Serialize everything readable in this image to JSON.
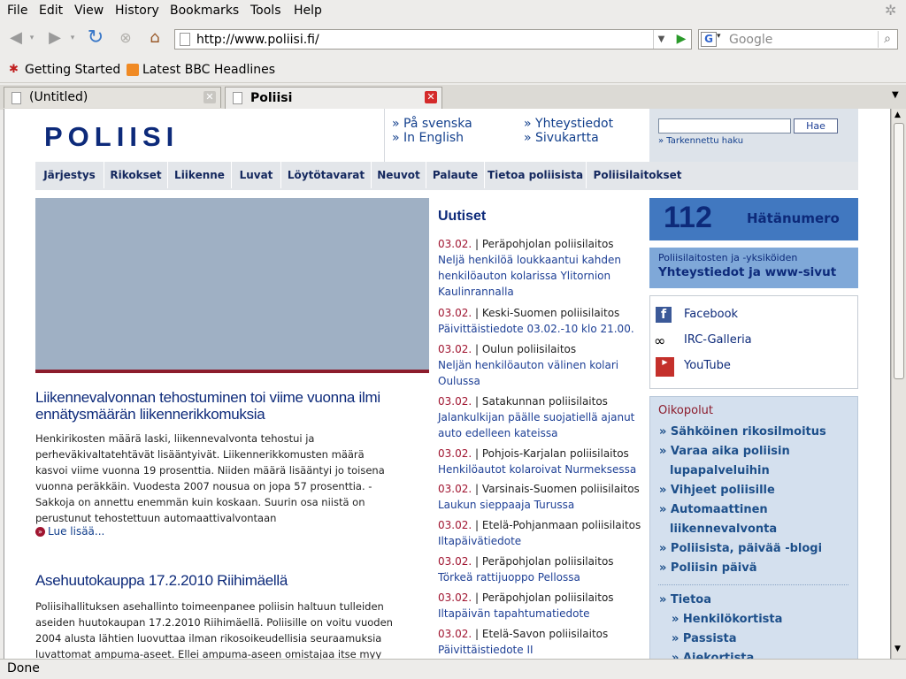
{
  "menu": [
    "File",
    "Edit",
    "View",
    "History",
    "Bookmarks",
    "Tools",
    "Help"
  ],
  "url": "http://www.poliisi.fi/",
  "search_placeholder": "Google",
  "bookmarks": [
    "Getting Started",
    "Latest BBC Headlines"
  ],
  "tabs": [
    {
      "label": "(Untitled)"
    },
    {
      "label": "Poliisi"
    }
  ],
  "status": "Done",
  "site": {
    "logo": "POLIISI",
    "lang_links": [
      "» På svenska",
      "» In English"
    ],
    "util_links": [
      "» Yhteystiedot",
      "» Sivukartta"
    ],
    "search_button": "Hae",
    "advanced_search": "» Tarkennettu haku",
    "nav": [
      "Järjestys",
      "Rikokset",
      "Liikenne",
      "Luvat",
      "Löytötavarat",
      "Neuvot",
      "Palaute",
      "Tietoa poliisista",
      "Poliisilaitokset"
    ],
    "article1": {
      "title": "Liikennevalvonnan tehostuminen toi viime vuonna ilmi ennätysmäärän liikennerikkomuksia",
      "body": "Henkirikosten määrä laski, liikennevalvonta tehostui ja perheväkivaltatehtävät lisääntyivät. Liikennerikkomusten määrä kasvoi viime vuonna 19 prosenttia. Niiden määrä lisääntyi jo toisena vuonna peräkkäin. Vuodesta 2007 nousua on jopa 57 prosenttia. - Sakkoja on annettu enemmän kuin koskaan. Suurin osa niistä on perustunut tehostettuun automaattivalvontaan",
      "more": "Lue lisää..."
    },
    "article2": {
      "title": "Asehuutokauppa 17.2.2010 Riihimäellä",
      "body": "Poliisihallituksen asehallinto toimeenpanee poliisin haltuun tulleiden aseiden huutokaupan 17.2.2010 Riihimäellä. Poliisille on voitu vuoden 2004 alusta lähtien luovuttaa ilman rikosoikeudellisia seuraamuksia luvattomat ampuma-aseet. Ellei ampuma-aseen omistajaa itse myy poliisin"
    },
    "news_heading": "Uutiset",
    "news": [
      {
        "date": "03.02.",
        "source": "| Peräpohjolan poliisilaitos",
        "title": "Neljä henkilöä loukkaantui kahden henkilöauton kolarissa Ylitornion Kaulinrannalla"
      },
      {
        "date": "03.02.",
        "source": "| Keski-Suomen poliisilaitos",
        "title": "Päivittäistiedote 03.02.-10 klo 21.00."
      },
      {
        "date": "03.02.",
        "source": "| Oulun poliisilaitos",
        "title": "Neljän henkilöauton välinen kolari Oulussa"
      },
      {
        "date": "03.02.",
        "source": "| Satakunnan poliisilaitos",
        "title": "Jalankulkijan päälle suojatiellä ajanut auto edelleen kateissa"
      },
      {
        "date": "03.02.",
        "source": "| Pohjois-Karjalan poliisilaitos",
        "title": "Henkilöautot kolaroivat Nurmeksessa"
      },
      {
        "date": "03.02.",
        "source": "| Varsinais-Suomen poliisilaitos",
        "title": "Laukun sieppaaja Turussa"
      },
      {
        "date": "03.02.",
        "source": "| Etelä-Pohjanmaan poliisilaitos",
        "title": "Iltapäivätiedote"
      },
      {
        "date": "03.02.",
        "source": "| Peräpohjolan poliisilaitos",
        "title": "Törkeä rattijuoppo Pellossa"
      },
      {
        "date": "03.02.",
        "source": "| Peräpohjolan poliisilaitos",
        "title": "Iltapäivän tapahtumatiedote"
      },
      {
        "date": "03.02.",
        "source": "| Etelä-Savon poliisilaitos",
        "title": "Päivittäistiedote II"
      }
    ],
    "emergency": {
      "number": "112",
      "label": "Hätänumero"
    },
    "contacts": {
      "line1": "Poliisilaitosten ja -yksiköiden",
      "line2": "Yhteystiedot ja www-sivut"
    },
    "social": [
      "Facebook",
      "IRC-Galleria",
      "YouTube"
    ],
    "shortcuts_heading": "Oikopolut",
    "shortcuts": [
      [
        "» Sähköinen rikosilmoitus"
      ],
      [
        "» Varaa aika poliisin",
        "lupapalveluihin"
      ],
      [
        "» Vihjeet poliisille"
      ],
      [
        "» Automaattinen",
        "liikennevalvonta"
      ],
      [
        "» Poliisista, päivää -blogi"
      ],
      [
        "» Poliisin päivä"
      ]
    ],
    "tietoa": {
      "heading": "» Tietoa",
      "items": [
        "» Henkilökortista",
        "» Passista",
        "» Aiekortista"
      ]
    }
  }
}
